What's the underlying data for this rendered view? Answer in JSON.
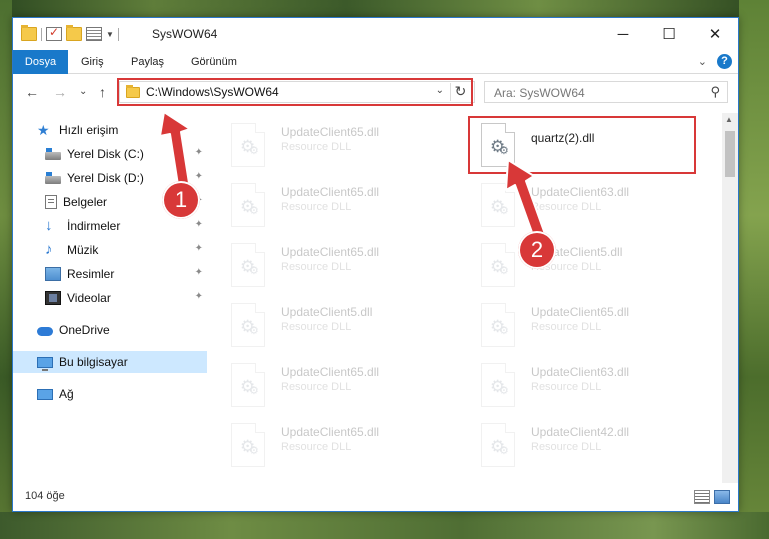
{
  "window": {
    "title": "SysWOW64",
    "controls": {
      "minimize": "─",
      "maximize": "☐",
      "close": "✕"
    }
  },
  "ribbon": {
    "tabs": [
      "Dosya",
      "Giriş",
      "Paylaş",
      "Görünüm"
    ],
    "help": "?",
    "collapse": "⌄"
  },
  "navigation": {
    "back": "←",
    "forward": "→",
    "recent": "⌄",
    "up": "↑",
    "address": "C:\\Windows\\SysWOW64",
    "address_dropdown": "⌄",
    "refresh": "↻",
    "search_placeholder": "Ara: SysWOW64",
    "search_icon": "⚲"
  },
  "sidebar": {
    "items": [
      {
        "label": "Hızlı erişim",
        "icon": "star-icon",
        "pinned": false
      },
      {
        "label": "Yerel Disk (C:)",
        "icon": "drive-icon",
        "pinned": true
      },
      {
        "label": "Yerel Disk (D:)",
        "icon": "drive-icon",
        "pinned": true
      },
      {
        "label": "Belgeler",
        "icon": "documents-icon",
        "pinned": true
      },
      {
        "label": "İndirmeler",
        "icon": "download-icon",
        "pinned": true
      },
      {
        "label": "Müzik",
        "icon": "music-icon",
        "pinned": true
      },
      {
        "label": "Resimler",
        "icon": "pictures-icon",
        "pinned": true
      },
      {
        "label": "Videolar",
        "icon": "videos-icon",
        "pinned": true
      },
      {
        "label": "OneDrive",
        "icon": "cloud-icon",
        "pinned": false
      },
      {
        "label": "Bu bilgisayar",
        "icon": "computer-icon",
        "pinned": false,
        "selected": true
      },
      {
        "label": "Ağ",
        "icon": "network-icon",
        "pinned": false
      }
    ],
    "pin_glyph": "📌"
  },
  "files": {
    "left_column": [
      {
        "name": "UpdateClient65.dll",
        "desc": "Resource DLL"
      },
      {
        "name": "UpdateClient65.dll",
        "desc": "Resource DLL"
      },
      {
        "name": "UpdateClient65.dll",
        "desc": "Resource DLL"
      },
      {
        "name": "UpdateClient5.dll",
        "desc": "Resource DLL"
      },
      {
        "name": "UpdateClient65.dll",
        "desc": "Resource DLL"
      },
      {
        "name": "UpdateClient65.dll",
        "desc": "Resource DLL"
      }
    ],
    "right_column": [
      {
        "name": "quartz(2).dll",
        "desc": "",
        "highlighted": true
      },
      {
        "name": "UpdateClient63.dll",
        "desc": "Resource DLL"
      },
      {
        "name": "UpdateClient5.dll",
        "desc": "Resource DLL"
      },
      {
        "name": "UpdateClient65.dll",
        "desc": "Resource DLL"
      },
      {
        "name": "UpdateClient63.dll",
        "desc": "Resource DLL"
      },
      {
        "name": "UpdateClient42.dll",
        "desc": "Resource DLL"
      }
    ]
  },
  "status": {
    "item_count": "104 öğe"
  },
  "annotations": {
    "badge_1": "1",
    "badge_2": "2",
    "accent": "#d83838"
  }
}
